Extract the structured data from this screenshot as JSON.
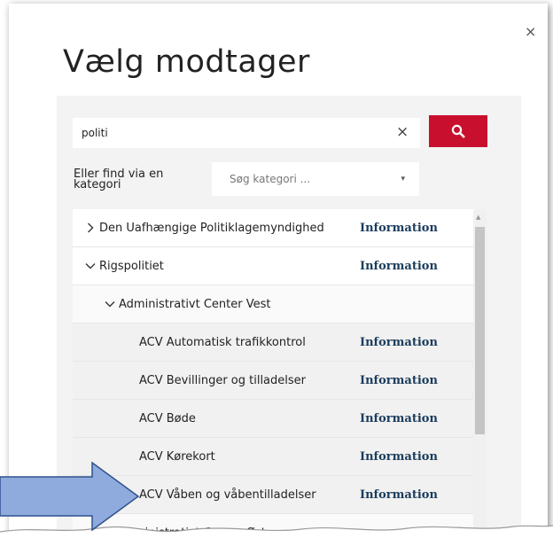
{
  "dialog": {
    "title": "Vælg modtager",
    "close_glyph": "×"
  },
  "search": {
    "value": "politi",
    "clear_glyph": "×",
    "button_icon": "search-icon"
  },
  "category": {
    "label": "Eller find via en kategori",
    "placeholder": "Søg kategori ...",
    "caret_glyph": "▾"
  },
  "list": {
    "info_label": "Information",
    "items": [
      {
        "name": "Den Uafhængige Politiklagemyndighed",
        "level": 1,
        "expanded": false,
        "has_info": true
      },
      {
        "name": "Rigspolitiet",
        "level": 1,
        "expanded": true,
        "has_info": true
      },
      {
        "name": "Administrativt Center Vest",
        "level": 2,
        "expanded": true,
        "has_info": false
      },
      {
        "name": "ACV Automatisk trafikkontrol",
        "level": 3,
        "has_info": true
      },
      {
        "name": "ACV Bevillinger og tilladelser",
        "level": 3,
        "has_info": true
      },
      {
        "name": "ACV Bøde",
        "level": 3,
        "has_info": true
      },
      {
        "name": "ACV Kørekort",
        "level": 3,
        "has_info": true
      },
      {
        "name": "ACV Våben og våbentilladelser",
        "level": 3,
        "has_info": true
      },
      {
        "name": "Administrativt Center Øst",
        "level": 2,
        "expanded": false,
        "has_info": false
      }
    ]
  },
  "colors": {
    "accent": "#c8102e",
    "info_text": "#1b3c5c",
    "arrow_fill": "#8faadc",
    "arrow_stroke": "#2f528f"
  }
}
